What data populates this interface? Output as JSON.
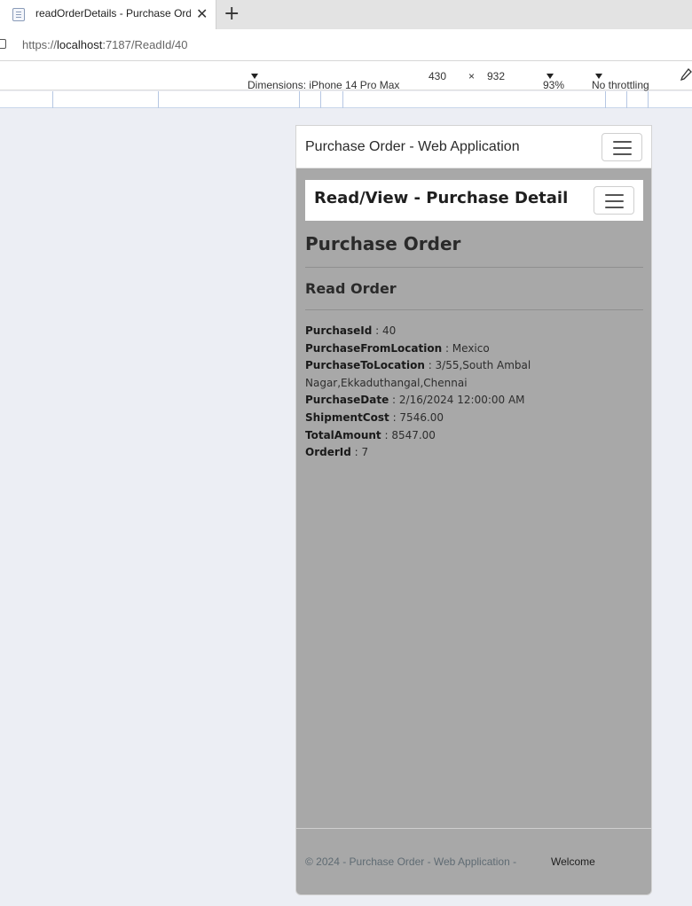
{
  "browser": {
    "tab_title": "readOrderDetails - Purchase Order - Web Application",
    "tab_close": "✕",
    "new_tab": "+",
    "url_prefix": "https://",
    "url_host": "localhost",
    "url_rest": ":7187/ReadId/40"
  },
  "devtools": {
    "dimensions_label": "Dimensions: iPhone 14 Pro Max",
    "width": "430",
    "times": "×",
    "height": "932",
    "zoom": "93%",
    "throttling": "No throttling"
  },
  "site": {
    "brand": "Purchase Order - Web Application",
    "inner_brand": "Read/View - Purchase Detail",
    "heading": "Purchase Order",
    "subheading": "Read Order",
    "fields": [
      {
        "label": "PurchaseId",
        "value": " : 40"
      },
      {
        "label": "PurchaseFromLocation",
        "value": " : Mexico"
      },
      {
        "label": "PurchaseToLocation",
        "value": " : 3/55,South Ambal Nagar,Ekkaduthangal,Chennai"
      },
      {
        "label": "PurchaseDate",
        "value": " : 2/16/2024 12:00:00 AM"
      },
      {
        "label": "ShipmentCost",
        "value": " : 7546.00"
      },
      {
        "label": "TotalAmount",
        "value": " : 8547.00"
      },
      {
        "label": "OrderId",
        "value": " : 7"
      }
    ],
    "footer_text": "© 2024 - Purchase Order - Web Application -",
    "footer_welcome": "Welcome"
  }
}
